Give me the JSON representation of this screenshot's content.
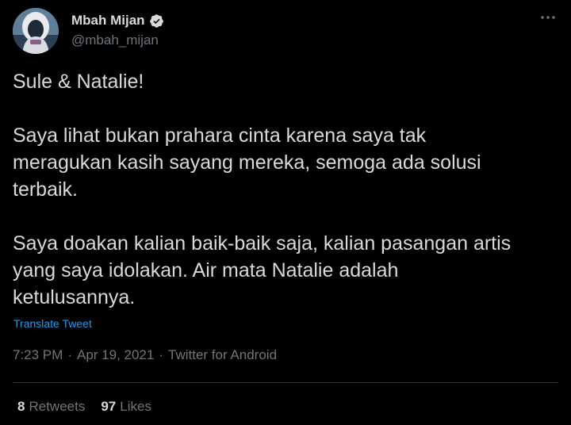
{
  "author": {
    "display_name": "Mbah Mijan",
    "handle": "@mbah_mijan",
    "verified": true,
    "avatar_icon": "avatar-hooded-figure"
  },
  "tweet": {
    "paragraphs": [
      "Sule & Natalie!",
      "Saya lihat bukan prahara cinta karena saya tak\nmeragukan kasih sayang mereka, semoga ada solusi\nterbaik.",
      "Saya doakan kalian baik-baik saja, kalian pasangan artis\nyang saya idolakan. Air mata Natalie adalah\nketulusannya."
    ],
    "translate_label": "Translate Tweet"
  },
  "meta": {
    "time": "7:23 PM",
    "separator": "·",
    "date": "Apr 19, 2021",
    "source": "Twitter for Android"
  },
  "stats": {
    "retweets_count": "8",
    "retweets_label": "Retweets",
    "likes_count": "97",
    "likes_label": "Likes"
  },
  "colors": {
    "background": "#000000",
    "text": "#d9d9d9",
    "secondary": "#6e767d",
    "accent": "#1d9bf0",
    "divider": "#2f3336"
  }
}
